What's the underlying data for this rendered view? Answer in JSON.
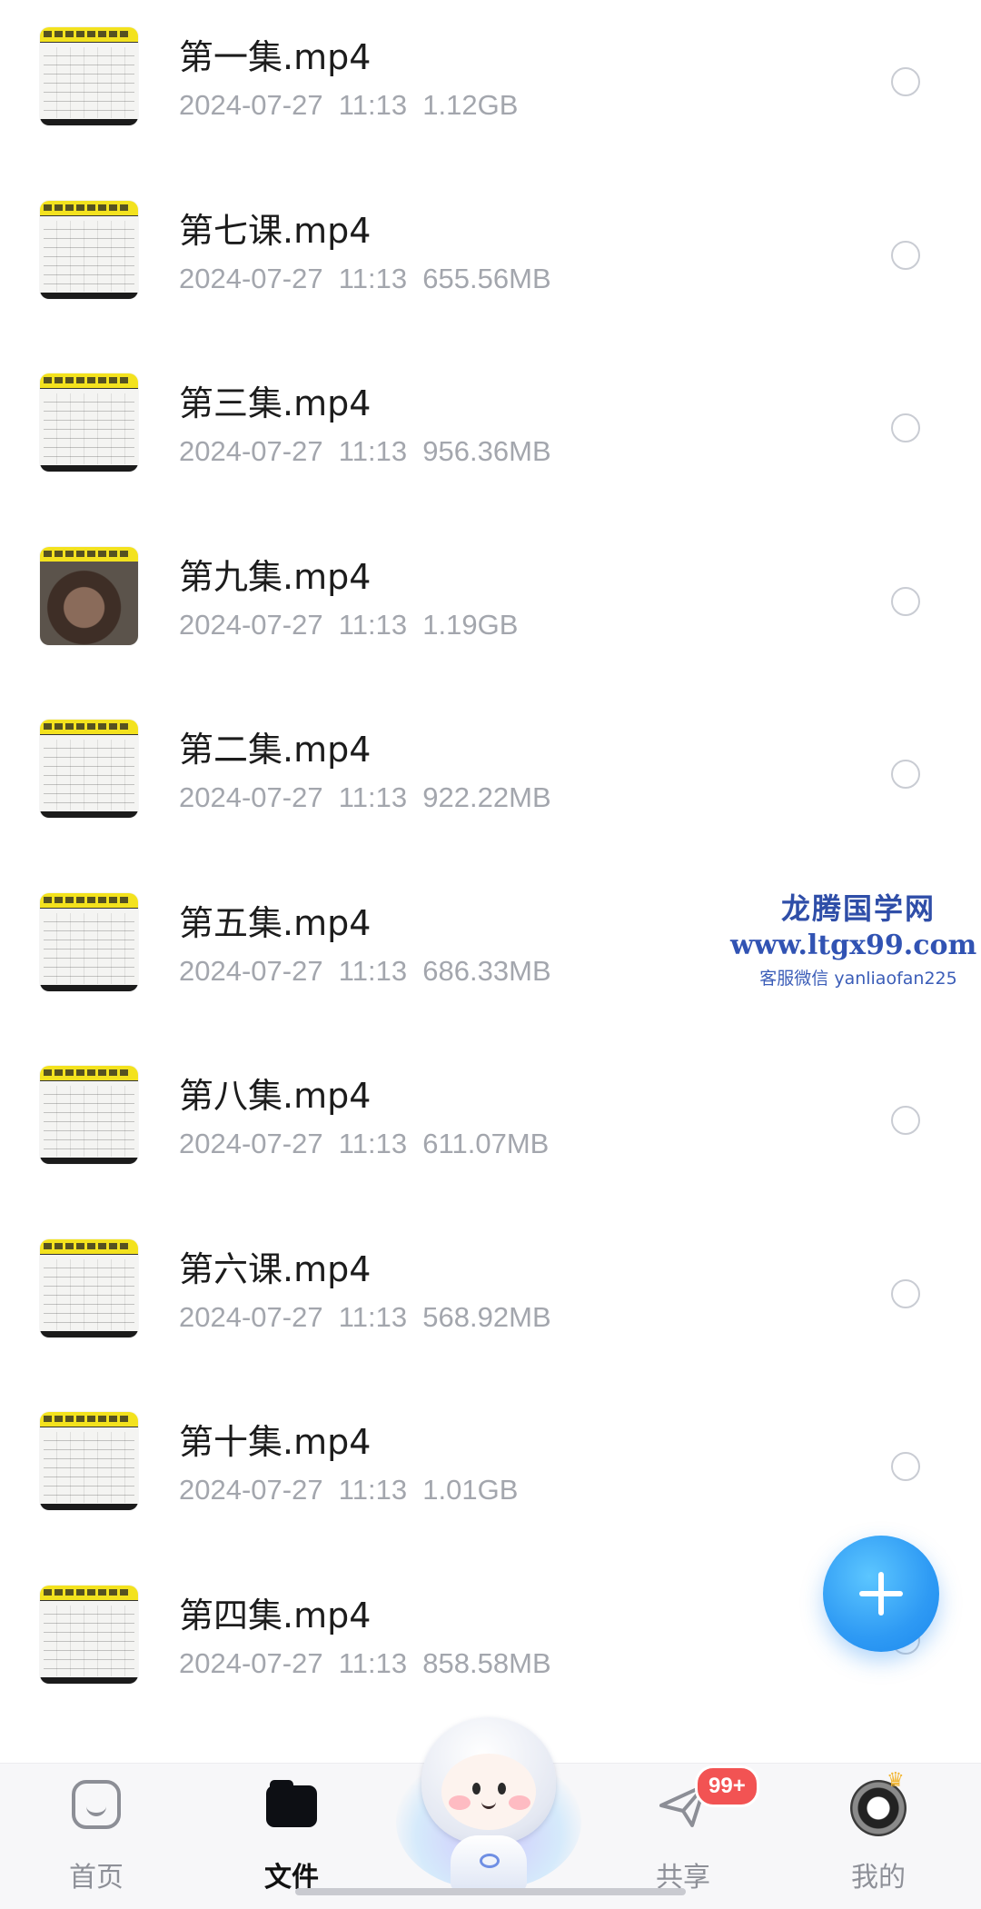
{
  "files": [
    {
      "name": "第一集.mp4",
      "meta": "2024-07-27  11:13  1.12GB",
      "thumb": "lecture"
    },
    {
      "name": "第七课.mp4",
      "meta": "2024-07-27  11:13  655.56MB",
      "thumb": "lecture"
    },
    {
      "name": "第三集.mp4",
      "meta": "2024-07-27  11:13  956.36MB",
      "thumb": "lecture"
    },
    {
      "name": "第九集.mp4",
      "meta": "2024-07-27  11:13  1.19GB",
      "thumb": "portrait"
    },
    {
      "name": "第二集.mp4",
      "meta": "2024-07-27  11:13  922.22MB",
      "thumb": "lecture"
    },
    {
      "name": "第五集.mp4",
      "meta": "2024-07-27  11:13  686.33MB",
      "thumb": "lecture"
    },
    {
      "name": "第八集.mp4",
      "meta": "2024-07-27  11:13  611.07MB",
      "thumb": "lecture"
    },
    {
      "name": "第六课.mp4",
      "meta": "2024-07-27  11:13  568.92MB",
      "thumb": "lecture"
    },
    {
      "name": "第十集.mp4",
      "meta": "2024-07-27  11:13  1.01GB",
      "thumb": "lecture"
    },
    {
      "name": "第四集.mp4",
      "meta": "2024-07-27  11:13  858.58MB",
      "thumb": "lecture"
    }
  ],
  "watermark": {
    "title": "龙腾国学网",
    "url": "www.ltgx99.com",
    "contact": "客服微信 yanliaofan225"
  },
  "fab": {
    "icon": "plus-icon"
  },
  "nav": {
    "home": {
      "label": "首页",
      "icon": "home-icon"
    },
    "files": {
      "label": "文件",
      "icon": "folder-icon"
    },
    "assistant": {
      "icon": "mascot-icon"
    },
    "share": {
      "label": "共享",
      "icon": "paper-plane-icon",
      "badge": "99+"
    },
    "mine": {
      "label": "我的",
      "icon": "avatar-icon"
    }
  },
  "colors": {
    "accent": "#2e9af4",
    "badge": "#f25353",
    "meta_text": "#a3a6ad"
  }
}
